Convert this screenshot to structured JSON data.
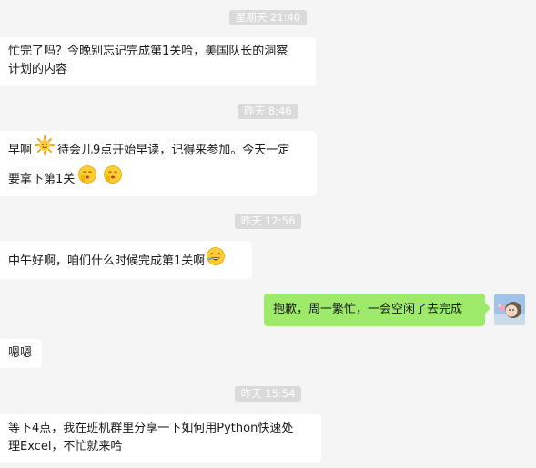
{
  "timestamps": [
    "星期天 21:40",
    "昨天 8:46",
    "昨天 12:56",
    "昨天 15:54"
  ],
  "messages": [
    {
      "line1": "忙完了吗？今晚别忘记完成第1关哈，美国队长的洞察",
      "line2": "计划的内容"
    },
    {
      "line1_a": "早啊",
      "line1_b": "待会儿9点开始早读，记得来参加。今天一定",
      "line2": "要拿下第1关"
    },
    {
      "text": "中午好啊，咱们什么时候完成第1关啊"
    },
    {
      "text": "抱歉，周一繁忙，一会空闲了去完成"
    },
    {
      "text": "嗯嗯"
    },
    {
      "line1": "等下4点，我在班机群里分享一下如何用Python快速处",
      "line2": "理Excel，不忙就来哈"
    }
  ],
  "icons": {
    "sun": "sun-emoji-icon",
    "shush": "shushing-face-emoji-icon",
    "laugh": "rolling-laughing-emoji-icon",
    "avatar": "user-avatar"
  },
  "colors": {
    "background": "#f5f5f5",
    "incoming_bubble": "#ffffff",
    "outgoing_bubble": "#9eea6a",
    "timestamp_pill": "#dadada"
  }
}
